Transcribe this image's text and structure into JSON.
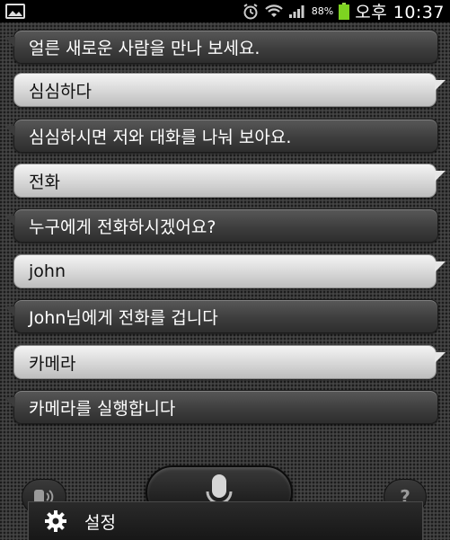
{
  "status_bar": {
    "battery_percent": "88%",
    "time": "오후 10:37",
    "icons": [
      "image-notification-icon",
      "alarm-icon",
      "wifi-icon",
      "signal-icon",
      "battery-icon"
    ]
  },
  "conversation": [
    {
      "role": "assistant",
      "text": "얼른 새로운 사람을 만나 보세요."
    },
    {
      "role": "user",
      "text": "심심하다"
    },
    {
      "role": "assistant",
      "text": "심심하시면 저와 대화를 나눠 보아요."
    },
    {
      "role": "user",
      "text": "전화"
    },
    {
      "role": "assistant",
      "text": "누구에게 전화하시겠어요?"
    },
    {
      "role": "user",
      "text": "john"
    },
    {
      "role": "assistant",
      "text": "John님에게 전화를 겁니다"
    },
    {
      "role": "user",
      "text": "카메라"
    },
    {
      "role": "assistant",
      "text": "카메라를 실행합니다"
    }
  ],
  "controls": {
    "speaker_icon": "speaker-icon",
    "mic_icon": "microphone-icon",
    "help_label": "?"
  },
  "menu": {
    "settings_label": "설정",
    "settings_icon": "gear-icon"
  },
  "colors": {
    "assistant_bubble": "#3e3e3e",
    "user_bubble": "#d4d4d4",
    "battery_fill": "#7ed321"
  }
}
